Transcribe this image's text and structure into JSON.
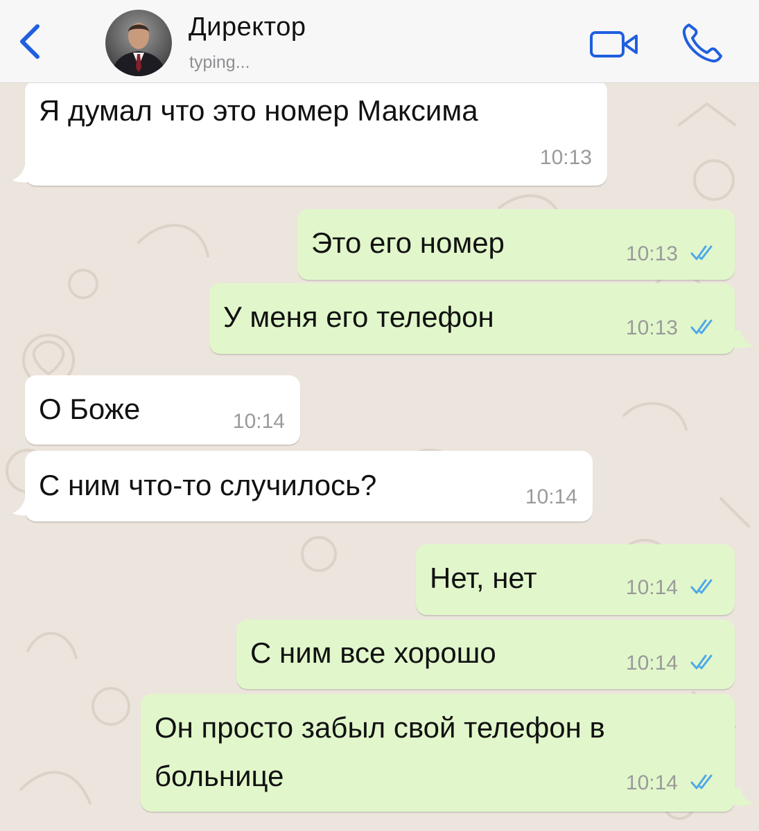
{
  "header": {
    "contact_name": "Директор",
    "status": "typing..."
  },
  "colors": {
    "accent": "#1f5fe0",
    "incoming_bubble": "#ffffff",
    "outgoing_bubble": "#e1f7cb",
    "read_ticks": "#4fa8e8",
    "chat_background": "#ece5dd"
  },
  "icons": {
    "back": "chevron-left-icon",
    "video_call": "video-camera-icon",
    "voice_call": "phone-icon",
    "read_receipt": "double-check-icon"
  },
  "messages": [
    {
      "direction": "in",
      "text": "Я думал что это номер Максима",
      "time": "10:13"
    },
    {
      "direction": "out",
      "text": "Это его номер",
      "time": "10:13",
      "read": true
    },
    {
      "direction": "out",
      "text": "У меня его телефон",
      "time": "10:13",
      "read": true
    },
    {
      "direction": "in",
      "text": "О Боже",
      "time": "10:14"
    },
    {
      "direction": "in",
      "text": "С ним что-то случилось?",
      "time": "10:14"
    },
    {
      "direction": "out",
      "text": "Нет, нет",
      "time": "10:14",
      "read": true
    },
    {
      "direction": "out",
      "text": "С ним все хорошо",
      "time": "10:14",
      "read": true
    },
    {
      "direction": "out",
      "text": "Он просто забыл свой телефон в",
      "text_line2": "больнице",
      "time": "10:14",
      "read": true
    }
  ]
}
